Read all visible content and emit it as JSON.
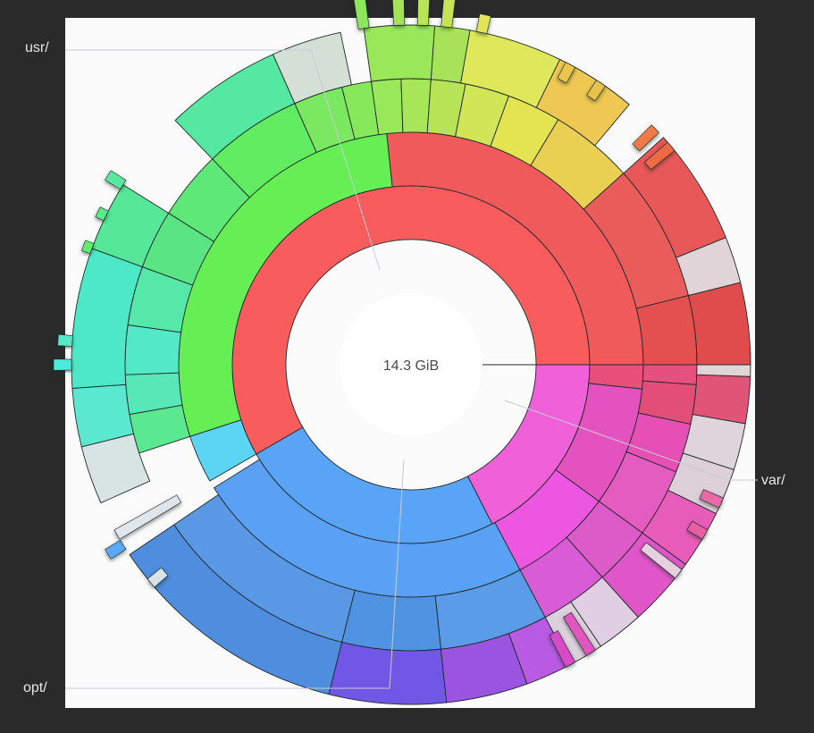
{
  "total": "14.3 GiB",
  "labels": {
    "usr": "usr/",
    "opt": "opt/",
    "var": "var/"
  },
  "colors": {
    "background": "#2a2a2a",
    "canvas": "#fbfbfb",
    "root": "#f85c5c",
    "usr": "#66ee55",
    "opt": "#5aa4f8",
    "var": "#f05ad0",
    "leader": "#c8cbd6"
  }
}
